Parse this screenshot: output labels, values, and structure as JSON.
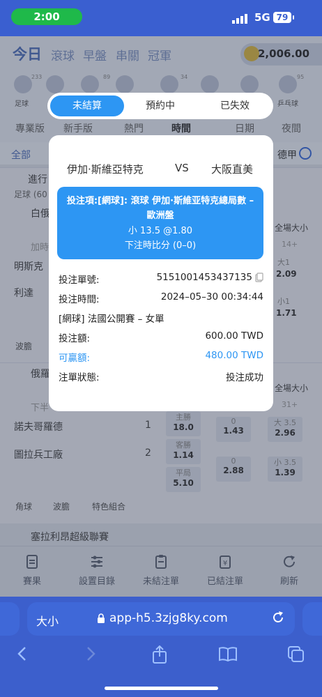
{
  "status": {
    "time": "2:00",
    "network": "5G",
    "battery": "79"
  },
  "header": {
    "nav": [
      "今日",
      "滾球",
      "早盤",
      "串關",
      "冠軍"
    ],
    "balance": "2,006.00"
  },
  "sports": [
    {
      "label": "足球",
      "count": "233"
    },
    {
      "label": "",
      "count": ""
    },
    {
      "label": "",
      "count": "89"
    },
    {
      "label": "",
      "count": ""
    },
    {
      "label": "",
      "count": "34"
    },
    {
      "label": "",
      "count": ""
    },
    {
      "label": "",
      "count": ""
    },
    {
      "label": "乒乓球",
      "count": "95"
    }
  ],
  "filters": [
    "專業版",
    "新手版",
    "熱門",
    "時間",
    "日期",
    "夜間"
  ],
  "row3": {
    "all": "全部",
    "right": "德甲"
  },
  "background": {
    "section1_head": "進行",
    "section1_sub": "足球 (60",
    "league1": "白俄",
    "add_time": "加時",
    "team_a": "明斯克",
    "team_b": "利達",
    "fulltime_size": "全場大小",
    "plus14": "14+",
    "big1": "大1",
    "odd_209": "2.09",
    "small1": "小1",
    "odd_171": "1.71",
    "wave": "波膽",
    "league2": "俄羅",
    "half": "下半",
    "team_c": "諾夫哥羅德",
    "team_d": "圖拉兵工廠",
    "score_c": "1",
    "score_d": "2",
    "home_win": "主勝",
    "home_odds": "18.0",
    "away_win": "客勝",
    "away_odds": "1.14",
    "draw": "平局",
    "draw_odds": "5.10",
    "zero1": "0",
    "hc1": "1.43",
    "zero2": "0",
    "hc2": "2.88",
    "fulltime_size2": "全場大小",
    "plus31": "31+",
    "big35": "大 3.5",
    "big35_odds": "2.96",
    "small35": "小 3.5",
    "small35_odds": "1.39",
    "chip_corner": "角球",
    "chip_wave": "波膽",
    "chip_special": "特色組合",
    "league3": "塞拉利昂超級聯賽"
  },
  "tabbar": [
    {
      "label": "賽果"
    },
    {
      "label": "設置目錄"
    },
    {
      "label": "未結注單"
    },
    {
      "label": "已結注單"
    },
    {
      "label": "刷新"
    }
  ],
  "browser": {
    "text_size": "大小",
    "url": "app-h5.3zjg8ky.com"
  },
  "tabs": {
    "active": "未結算",
    "second": "預約中",
    "third": "已失效"
  },
  "dialog": {
    "home": "伊加·斯維亞特克",
    "vs": "VS",
    "away": "大阪直美",
    "bet_line1": "投注項:[網球]: 滾球 伊加·斯維亚特克總局數 – 歐洲盤",
    "bet_line2": "小 13.5 @1.80",
    "bet_line3": "下注時比分 (0–0)",
    "rows": [
      {
        "label": "投注單號:",
        "value": "5151001453437135"
      },
      {
        "label": "投注時間:",
        "value": "2024–05–30 00:34:44"
      },
      {
        "label": "[網球] 法國公開賽 – 女單",
        "value": ""
      },
      {
        "label": "投注額:",
        "value": "600.00 TWD"
      },
      {
        "label": "可贏額:",
        "value": "480.00 TWD"
      },
      {
        "label": "注單狀態:",
        "value": "投注成功"
      }
    ]
  },
  "colors": {
    "accent": "#2d96f3",
    "status_green": "#1fb94a",
    "browser_blue": "#3c5fcc"
  }
}
